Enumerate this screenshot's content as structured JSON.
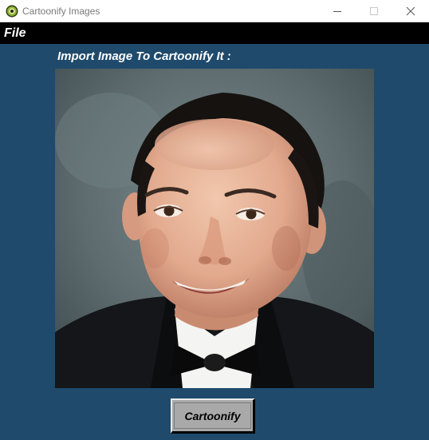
{
  "window": {
    "title": "Cartoonify Images",
    "icons": {
      "app": "cartoonify-app-icon",
      "minimize": "minimize-icon",
      "maximize": "maximize-icon",
      "close": "close-icon"
    }
  },
  "menu": {
    "items": [
      {
        "label": "File"
      }
    ]
  },
  "main": {
    "prompt": "Import Image To Cartoonify It :",
    "image": {
      "subject": "portrait photo of a smiling man in a tuxedo and bow tie"
    },
    "action_button": "Cartoonify"
  },
  "colors": {
    "background": "#1f4a6b",
    "menubar": "#000000",
    "button": "#a9a9a9",
    "text": "#ffffff"
  }
}
